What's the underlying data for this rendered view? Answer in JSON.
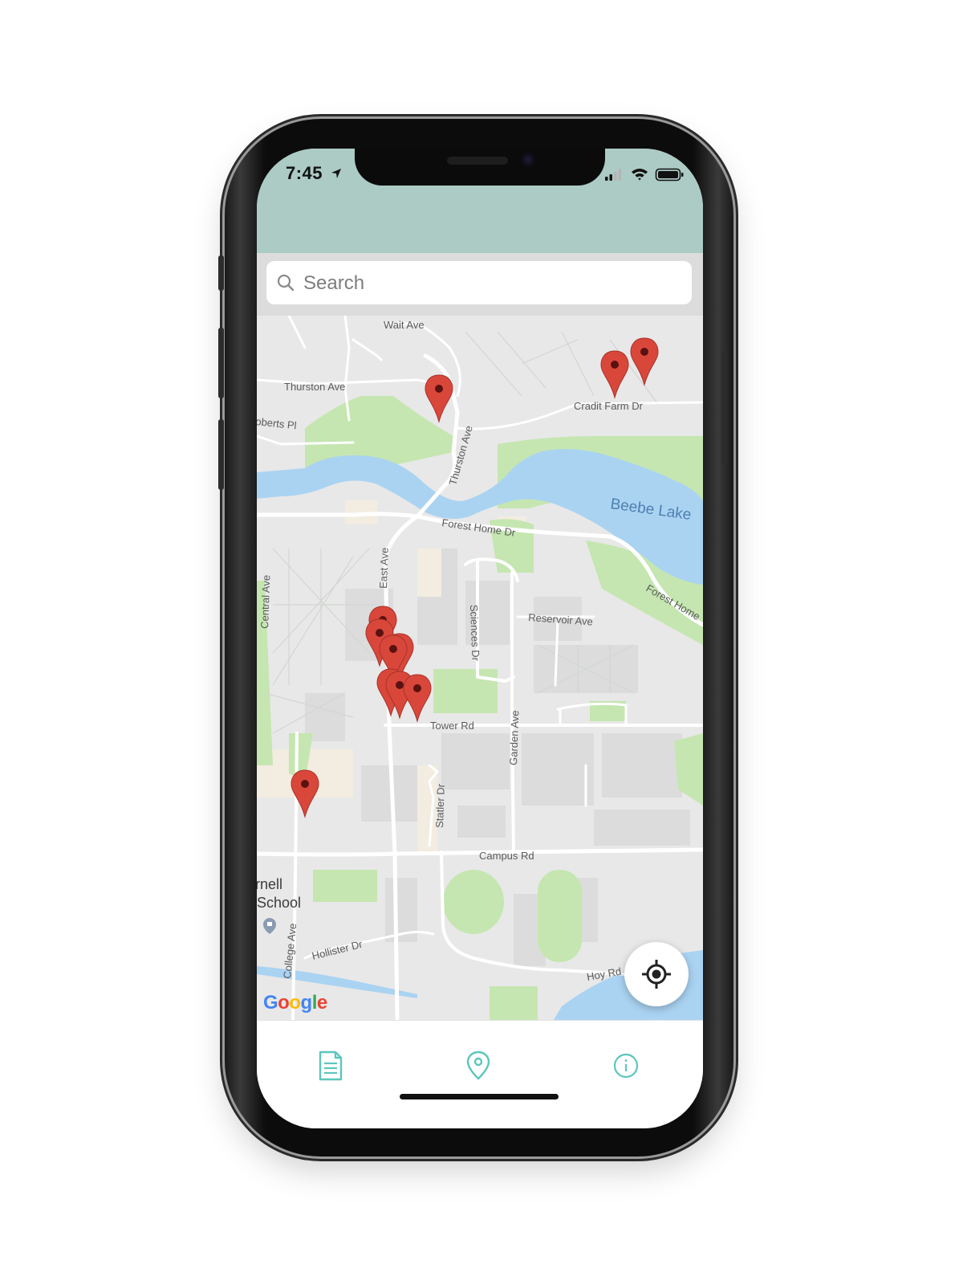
{
  "status_bar": {
    "time": "7:45",
    "icons": [
      "location-arrow-icon",
      "signal-icon",
      "wifi-icon",
      "battery-icon"
    ]
  },
  "search": {
    "placeholder": "Search",
    "value": ""
  },
  "map": {
    "labels": {
      "wait_ave": "Wait Ave",
      "thurston_ave_west": "Thurston Ave",
      "roberts_pl": "oberts Pl",
      "thurston_ave_diag": "Thurston Ave",
      "cradit_farm_dr": "Cradit Farm Dr",
      "beebe_lake": "Beebe Lake",
      "forest_home_dr": "Forest Home Dr",
      "forest_home_east": "Forest Home",
      "east_ave": "East Ave",
      "central_ave": "Central Ave",
      "sciences_dr": "Sciences Dr",
      "reservoir_ave": "Reservoir Ave",
      "tower_rd": "Tower Rd",
      "garden_ave": "Garden Ave",
      "statler_dr": "Statler Dr",
      "campus_rd": "Campus Rd",
      "cornell": "rnell",
      "school": "School",
      "college_ave": "College Ave",
      "hollister_dr": "Hollister Dr",
      "hoy_rd": "Hoy Rd"
    },
    "attribution": "Google",
    "marker_count": 12,
    "marker_color": "#d9473b"
  },
  "tabs": [
    {
      "name": "list",
      "icon": "document-icon"
    },
    {
      "name": "map",
      "icon": "map-pin-icon"
    },
    {
      "name": "info",
      "icon": "info-icon"
    }
  ],
  "colors": {
    "header": "#abcbc4",
    "accent": "#5cc6bc",
    "water": "#aad3f2",
    "park": "#c5e6b0"
  }
}
